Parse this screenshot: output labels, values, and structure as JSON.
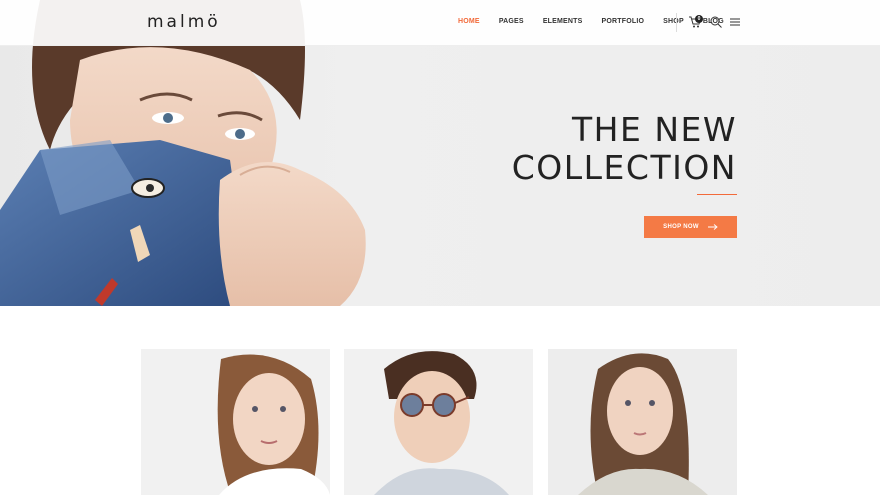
{
  "header": {
    "logo": "malmö",
    "nav": [
      {
        "label": "HOME",
        "active": true
      },
      {
        "label": "PAGES",
        "active": false
      },
      {
        "label": "ELEMENTS",
        "active": false
      },
      {
        "label": "PORTFOLIO",
        "active": false
      },
      {
        "label": "SHOP",
        "active": false
      },
      {
        "label": "BLOG",
        "active": false
      }
    ],
    "cart_count": "0",
    "icons": [
      "cart-icon",
      "search-icon",
      "menu-icon"
    ]
  },
  "hero": {
    "title_line1": "THE NEW",
    "title_line2": "COLLECTION",
    "button_label": "SHOP NOW"
  },
  "colors": {
    "accent": "#f26a3a",
    "button": "#f47a45",
    "text": "#222222"
  }
}
